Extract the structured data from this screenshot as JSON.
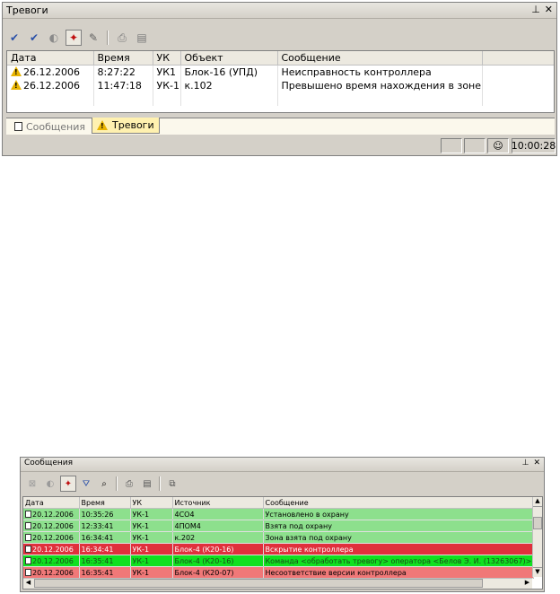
{
  "alarms_panel": {
    "title": "Тревоги",
    "pin_icon": "pin-icon",
    "close_icon": "close-icon",
    "columns": [
      "Дата",
      "Время",
      "УК",
      "Объект",
      "Сообщение"
    ],
    "rows": [
      {
        "date": "26.12.2006",
        "time": "8:27:22",
        "uk": "УК1",
        "object": "Блок-16 (УПД)",
        "message": "Неисправность контроллера"
      },
      {
        "date": "26.12.2006",
        "time": "11:47:18",
        "uk": "УК-1",
        "object": "к.102",
        "message": "Превышено время нахождения в зоне"
      }
    ],
    "tabs": [
      {
        "label": "Сообщения",
        "icon": "messages-icon",
        "active": false
      },
      {
        "label": "Тревоги",
        "icon": "warning-icon",
        "active": true
      }
    ],
    "status_time": "10:00:28"
  },
  "messages_panel": {
    "title": "Сообщения",
    "columns": [
      "Дата",
      "Время",
      "УК",
      "Источник",
      "Сообщение"
    ],
    "rows": [
      {
        "date": "20.12.2006",
        "time": "10:35:26",
        "uk": "УК-1",
        "source": "4СО4",
        "message": "Установлено в охрану",
        "color": "#8de08d"
      },
      {
        "date": "20.12.2006",
        "time": "12:33:41",
        "uk": "УК-1",
        "source": "4ПОМ4",
        "message": "Взята под охрану",
        "color": "#8de08d"
      },
      {
        "date": "20.12.2006",
        "time": "16:34:41",
        "uk": "УК-1",
        "source": "к.202",
        "message": "Зона взята под охрану",
        "color": "#8de08d"
      },
      {
        "date": "20.12.2006",
        "time": "16:34:41",
        "uk": "УК-1",
        "source": "Блок-4 (К20-16)",
        "message": "Вскрытие контроллера",
        "color": "#e0303c"
      },
      {
        "date": "20.12.2006",
        "time": "16:35:41",
        "uk": "УК-1",
        "source": "Блок-4 (К20-16)",
        "message": "Команда <обработать тревогу> оператора <Белов Э. И. (13263067)>",
        "color": "#10e020"
      },
      {
        "date": "20.12.2006",
        "time": "16:35:41",
        "uk": "УК-1",
        "source": "Блок-4 (К20-07)",
        "message": "Несоответствие версии контроллера",
        "color": "#f07878"
      }
    ]
  }
}
